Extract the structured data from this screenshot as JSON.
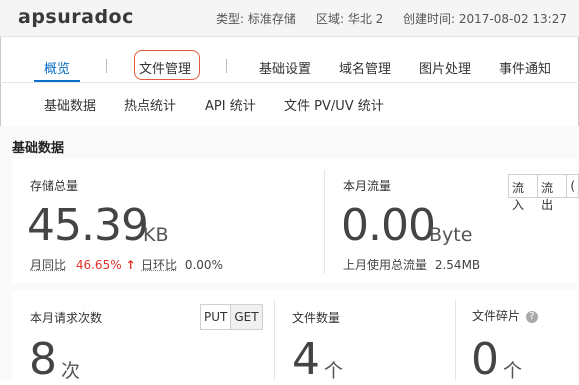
{
  "header": {
    "bucket_name": "apsuradoc",
    "type_label": "类型: 标准存储",
    "region_label": "区域: 华北 2",
    "created_label": "创建时间: 2017-08-02 13:27"
  },
  "tabs": [
    {
      "label": "概览",
      "active": true
    },
    {
      "label": "文件管理",
      "active": false
    },
    {
      "label": "基础设置",
      "active": false
    },
    {
      "label": "域名管理",
      "active": false
    },
    {
      "label": "图片处理",
      "active": false
    },
    {
      "label": "事件通知",
      "active": false
    }
  ],
  "subtabs": [
    "基础数据",
    "热点统计",
    "API 统计",
    "文件 PV/UV 统计"
  ],
  "section_title": "基础数据",
  "storage": {
    "label": "存储总量",
    "value": "45.39",
    "unit": "KB",
    "mom_label": "月同比",
    "mom_value": "46.65%",
    "mom_arrow": "↑",
    "dod_label": "日环比",
    "dod_value": "0.00%"
  },
  "traffic": {
    "label": "本月流量",
    "value": "0.00",
    "unit": "Byte",
    "toggle": [
      "流入",
      "流出",
      "("
    ],
    "used_label": "上月使用总流量",
    "used_value": "2.54MB"
  },
  "requests": {
    "label": "本月请求次数",
    "value": "8",
    "unit": "次",
    "toggle": [
      "PUT",
      "GET"
    ]
  },
  "files": {
    "label": "文件数量",
    "value": "4",
    "unit": "个"
  },
  "fragments": {
    "label": "文件碎片",
    "help": "?",
    "value": "0",
    "unit": "个"
  },
  "colors": {
    "accent": "#0a6fc7",
    "highlight_outline": "#e05a3c",
    "increase": "#e2342b"
  }
}
